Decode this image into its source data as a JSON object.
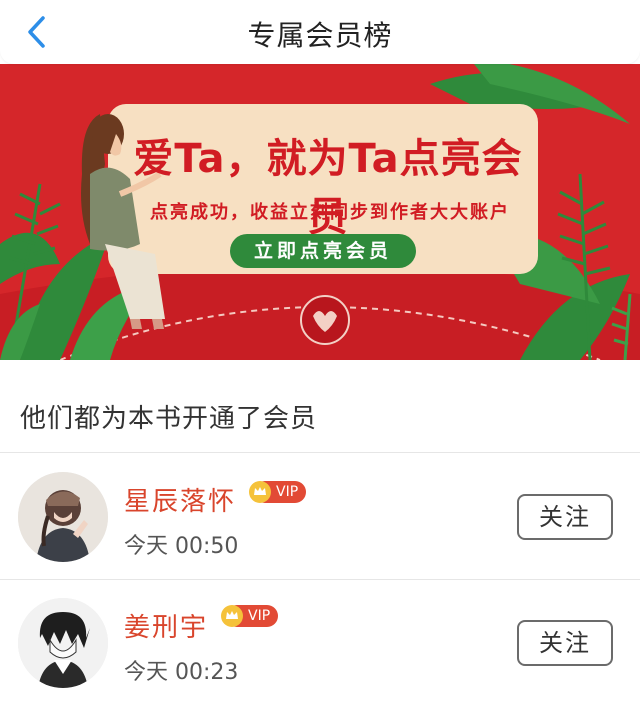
{
  "header": {
    "title": "专属会员榜"
  },
  "banner": {
    "headline": "爱Ta，就为Ta点亮会员",
    "subtitle": "点亮成功，收益立刻同步到作者大大账户",
    "button_label": "立即点亮会员",
    "colors": {
      "background": "#d5262a",
      "card": "#f7e0c2",
      "button": "#2f8a3b",
      "text": "#d11c23"
    }
  },
  "section": {
    "label": "他们都为本书开通了会员"
  },
  "members": [
    {
      "name": "星辰落怀",
      "vip_label": "VIP",
      "time": "今天 00:50",
      "follow_label": "关注"
    },
    {
      "name": "姜刑宇",
      "vip_label": "VIP",
      "time": "今天 00:23",
      "follow_label": "关注"
    }
  ],
  "icons": {
    "back": "chevron-left-icon",
    "vip": "crown-icon"
  }
}
